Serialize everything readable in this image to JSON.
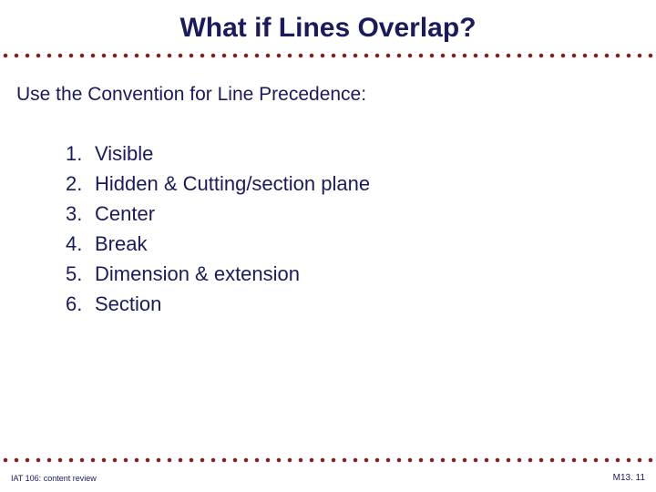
{
  "title": "What if Lines Overlap?",
  "intro": "Use the Convention for Line Precedence:",
  "items": [
    {
      "num": "1.",
      "text": "Visible"
    },
    {
      "num": "2.",
      "text": "Hidden  &  Cutting/section plane"
    },
    {
      "num": "3.",
      "text": "Center"
    },
    {
      "num": "4.",
      "text": "Break"
    },
    {
      "num": "5.",
      "text": "Dimension  &  extension"
    },
    {
      "num": "6.",
      "text": "Section"
    }
  ],
  "footer_left": "IAT 106: content review",
  "footer_right": "M13. 11"
}
